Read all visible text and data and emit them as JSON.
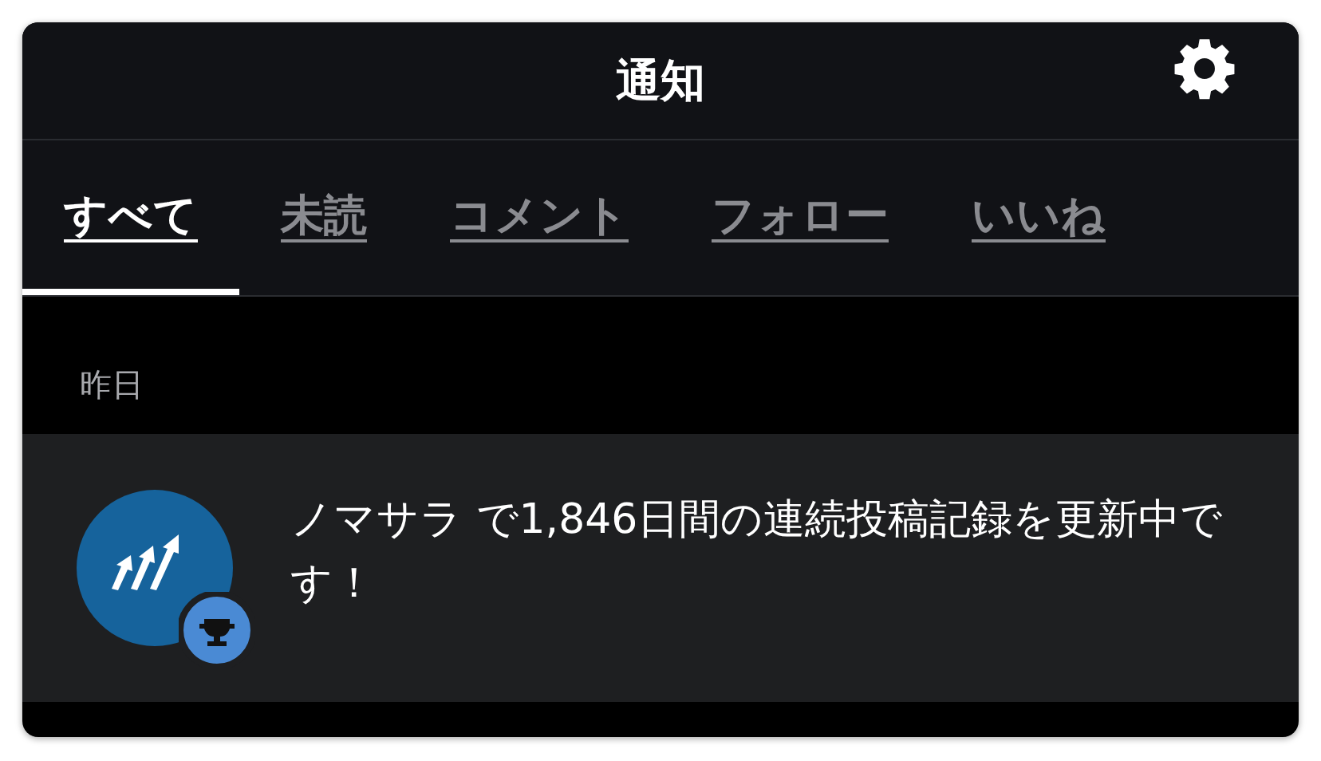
{
  "header": {
    "title": "通知"
  },
  "tabs": [
    {
      "label": "すべて",
      "selected": true
    },
    {
      "label": "未読",
      "selected": false
    },
    {
      "label": "コメント",
      "selected": false
    },
    {
      "label": "フォロー",
      "selected": false
    },
    {
      "label": "いいね",
      "selected": false
    }
  ],
  "sections": [
    {
      "heading": "昨日",
      "notifications": [
        {
          "text": "ノマサラ で1,846日間の連続投稿記録を更新中です！"
        }
      ]
    }
  ]
}
